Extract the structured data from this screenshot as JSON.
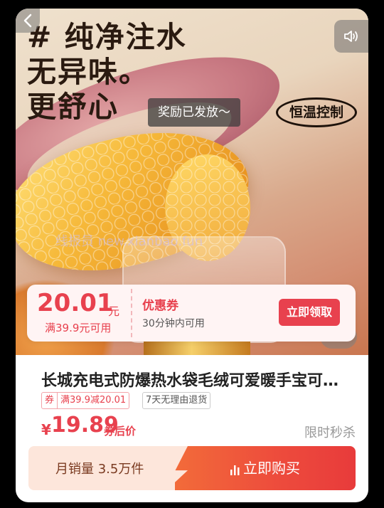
{
  "hero": {
    "headline": [
      "# 纯净注水",
      "无异味。",
      "更舒心"
    ],
    "reward_toast": "奖励已发放～",
    "temp_badge": "恒温控制",
    "watermark": "线报员 new.xianbao.fun"
  },
  "coupon": {
    "amount": "20.01",
    "unit": "元",
    "condition": "满39.9元可用",
    "title": "优惠券",
    "subtitle": "30分钟内可用",
    "claim_label": "立即领取"
  },
  "product": {
    "title": "长城充电式防爆热水袋毛绒可爱暖手宝可…",
    "tag_coupon_kind": "券",
    "tag_coupon_text": "满39.9减20.01",
    "tag_return": "7天无理由退货",
    "currency": "¥",
    "price": "19.89",
    "price_suffix": "券后价",
    "flash_sale": "限时秒杀"
  },
  "buy_bar": {
    "sales": "月销量 3.5万件",
    "buy_label": "立即购买"
  },
  "icons": {
    "back": "back-arrow-icon",
    "sound": "speaker-icon",
    "bars": "bar-chart-icon"
  },
  "colors": {
    "accent": "#e8414e",
    "buy_gradient_start": "#f26b3a",
    "buy_gradient_end": "#e83b3b"
  }
}
